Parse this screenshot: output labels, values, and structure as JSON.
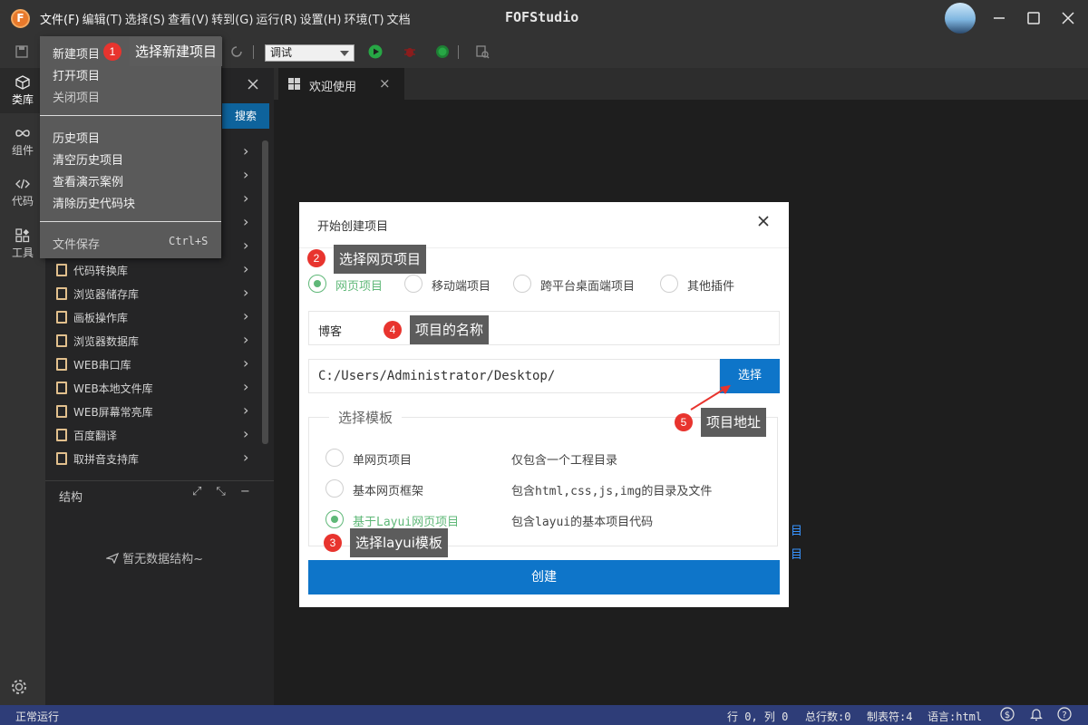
{
  "app": {
    "title": "FOFStudio",
    "logo_letter": "F"
  },
  "menu": [
    "文件(F)",
    "编辑(T)",
    "选择(S)",
    "查看(V)",
    "转到(G)",
    "运行(R)",
    "设置(H)",
    "环境(T)",
    "文档"
  ],
  "toolbar": {
    "run_mode": "调试"
  },
  "activity": [
    {
      "label": "类库",
      "icon": "cube-icon"
    },
    {
      "label": "组件",
      "icon": "infinity-icon"
    },
    {
      "label": "代码",
      "icon": "code-icon"
    },
    {
      "label": "工具",
      "icon": "tools-icon"
    }
  ],
  "sidebar": {
    "search_label": "搜索",
    "libraries": [
      "代码转换库",
      "浏览器储存库",
      "画板操作库",
      "浏览器数据库",
      "WEB串口库",
      "WEB本地文件库",
      "WEB屏幕常亮库",
      "百度翻译",
      "取拼音支持库"
    ],
    "structure_title": "结构",
    "empty_structure": "暂无数据结构~"
  },
  "file_menu": {
    "new_project": "新建项目",
    "open_project": "打开项目",
    "close_project": "关闭项目",
    "history_project": "历史项目",
    "clear_history": "清空历史项目",
    "view_demos": "查看演示案例",
    "clear_code_history": "清除历史代码块",
    "save_file": "文件保存",
    "save_shortcut": "Ctrl+S"
  },
  "editor": {
    "tab_label": "欢迎使用"
  },
  "dialog": {
    "title": "开始创建项目",
    "project_types": [
      "网页项目",
      "移动端项目",
      "跨平台桌面端项目",
      "其他插件"
    ],
    "selected_type": 0,
    "project_name": "博客",
    "project_path": "C:/Users/Administrator/Desktop/",
    "choose_label": "选择",
    "template_legend": "选择模板",
    "templates": [
      {
        "name": "单网页项目",
        "desc": "仅包含一个工程目录"
      },
      {
        "name": "基本网页框架",
        "desc": "包含html,css,js,img的目录及文件"
      },
      {
        "name": "基于Layui网页项目",
        "desc": "包含layui的基本项目代码"
      }
    ],
    "selected_template": 2,
    "create_label": "创建"
  },
  "annotations": [
    {
      "num": "1",
      "text": "选择新建项目"
    },
    {
      "num": "2",
      "text": "选择网页项目"
    },
    {
      "num": "3",
      "text": "选择layui模板"
    },
    {
      "num": "4",
      "text": "项目的名称"
    },
    {
      "num": "5",
      "text": "项目地址"
    }
  ],
  "colors": {
    "accent_blue": "#0e75c9",
    "status_bar": "#2e3d78",
    "selected_green": "#5fb878",
    "badge_red": "#e8342e"
  },
  "status": {
    "left": "正常运行",
    "position": "行 0, 列 0",
    "total_lines": "总行数:0",
    "tab_size": "制表符:4",
    "language": "语言:html"
  }
}
